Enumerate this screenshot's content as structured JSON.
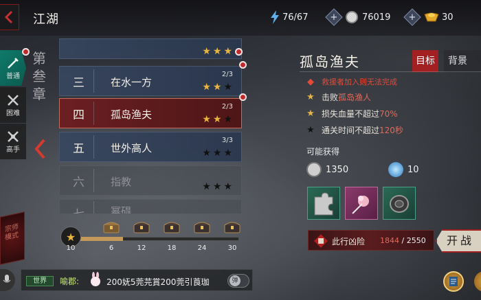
{
  "header": {
    "title": "江湖",
    "stamina": "76/67",
    "silver": "76019",
    "gold": "30"
  },
  "side_tabs": [
    {
      "label": "普通",
      "active": true
    },
    {
      "label": "困难",
      "active": false
    },
    {
      "label": "高手",
      "active": false
    }
  ],
  "master_seal": "宗师模式",
  "chapter": {
    "chars": [
      "第",
      "叁",
      "章"
    ]
  },
  "stages": [
    {
      "num": "",
      "name": "",
      "progress": "",
      "stars": "★★★"
    },
    {
      "num": "三",
      "name": "在水一方",
      "progress": "2/3",
      "stars_gold": "★★",
      "stars_dark": "★"
    },
    {
      "num": "四",
      "name": "孤岛渔夫",
      "progress": "2/3",
      "stars_gold": "★★",
      "stars_dark": "★"
    },
    {
      "num": "五",
      "name": "世外高人",
      "progress": "3/3",
      "stars_gold": "",
      "stars_dark": "★★★"
    },
    {
      "num": "六",
      "name": "指教",
      "progress": "",
      "stars_gold": "",
      "stars_dark": "★★★"
    },
    {
      "num": "七",
      "name": "幂碍",
      "progress": "",
      "stars_gold": "",
      "stars_dark": ""
    }
  ],
  "star_progress": {
    "current": "10",
    "fill_fraction": 0.27,
    "milestones": [
      "6",
      "12",
      "18",
      "24",
      "30"
    ]
  },
  "chat": {
    "channel": "世界",
    "sender": "喻郡:",
    "message": "200妩5莞芫賞200莞引莨珈",
    "toggle": "弹"
  },
  "detail": {
    "stage_name": "孤岛渔夫",
    "tab_goal": "目标",
    "tab_background": "背景",
    "warning": "救援者加入则无法完成",
    "conditions": [
      {
        "pre": "击败",
        "hl": "孤岛渔人",
        "post": ""
      },
      {
        "pre": "损失血量不超过",
        "hl": "70%",
        "post": ""
      },
      {
        "pre": "通关时间不超过",
        "hl": "120秒",
        "post": ""
      }
    ],
    "rewards_label": "可能获得",
    "reward_silver": "1350",
    "reward_exp": "10",
    "danger_label": "此行凶险",
    "danger_current": "1844",
    "danger_total": "/ 2550",
    "fight_label": "开战"
  }
}
